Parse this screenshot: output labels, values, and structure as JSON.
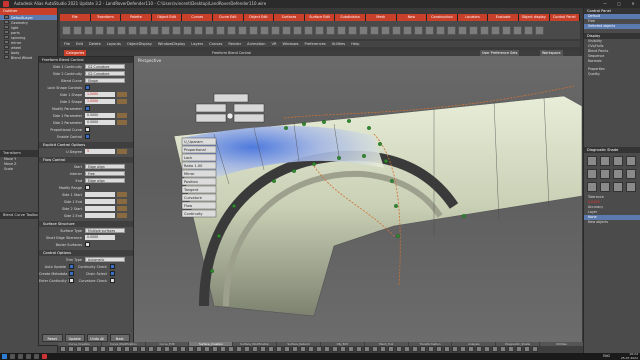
{
  "window": {
    "title": "Autodesk Alias AutoStudio 2021 Update 3.2 - LandRoverDefender110 - C:\\Users\\vincent\\Desktop\\LandRoverDefender110.wire"
  },
  "shelf_tabs": [
    "File",
    "Transform",
    "Palette",
    "Object Edit",
    "Curves",
    "Curve Edit",
    "Object Edit",
    "Surfaces",
    "Surface Edit",
    "Subdivision",
    "Mesh",
    "New",
    "Construction",
    "Locators",
    "Evaluate",
    "Object display",
    "Control Panel"
  ],
  "menu": [
    "File",
    "Edit",
    "Delete",
    "Layouts",
    "ObjectDisplay",
    "WindowDisplay",
    "Layers",
    "Canvas",
    "Render",
    "Animation",
    "VR",
    "Windows",
    "Preferences",
    "Utilities",
    "Help"
  ],
  "subbar": {
    "category": "Categories",
    "tool": "Freeform Blend Control",
    "user_prefs": "User Preference Sets",
    "workspace": "Workspace"
  },
  "outliner": {
    "header": "Outliner",
    "items": [
      "DefaultLayer",
      "Geometry",
      "light",
      "parts",
      "spinning",
      "mirror",
      "wheel",
      "body",
      "Blend Wheel"
    ]
  },
  "left_misc": {
    "transform": "Transform",
    "move_y": "Move Y",
    "move_z": "Move Z",
    "scale": "Scale",
    "curve_view": "Blend Curve Toolbox"
  },
  "control_panel": {
    "title": "Freeform Blend Control",
    "rows": [
      {
        "label": "Side 1 Continuity",
        "value": "G2 Curvature"
      },
      {
        "label": "Side 2 Continuity",
        "value": "G2 Curvature"
      },
      {
        "label": "Blend Curve",
        "value": "Shape"
      },
      {
        "label": "Lock Shape Controls",
        "value": ""
      },
      {
        "label": "Side 1 Shape",
        "value": "1.0000"
      },
      {
        "label": "Side 2 Shape",
        "value": "1.0000"
      },
      {
        "label": "Modify Parameter",
        "value": ""
      },
      {
        "label": "Side 1 Parameter",
        "value": "0.5000"
      },
      {
        "label": "Side 2 Parameter",
        "value": "0.5000"
      },
      {
        "label": "Proportional Curve",
        "value": ""
      },
      {
        "label": "Enable Control",
        "value": ""
      }
    ],
    "section_explicit": "Explicit Control Options",
    "udegree_label": "U Degree",
    "udegree_value": "5",
    "section_flow": "Flow Control",
    "flow_rows": [
      {
        "label": "Start",
        "value": "Edge align"
      },
      {
        "label": "Interior",
        "value": "Free"
      },
      {
        "label": "End",
        "value": "Edge align"
      }
    ],
    "modify_range": "Modify Range",
    "range_rows": [
      "Side 1 Start",
      "Side 1 End",
      "Side 2 Start",
      "Side 2 End"
    ],
    "section_structure": "Surface Structure",
    "surface_type_label": "Surface Type",
    "surface_type_value": "Multiple surfaces",
    "short_edge_label": "Short Edge Tolerance",
    "short_edge_value": "0.0000",
    "bezier_label": "Bezier Surfaces",
    "section_options": "Control Options",
    "trim_type_label": "Trim Type",
    "trim_type_value": "Automatic",
    "auto_update": "Auto Update",
    "continuity_check": "Continuity Check",
    "create_metadata": "Create Metadata",
    "chain_select": "Chain Select",
    "enter_continuity": "Enter Continuity Check",
    "curvature_check": "Curvature Check",
    "buttons": [
      "Reset",
      "Update",
      "Undo All",
      "Next"
    ]
  },
  "viewport": {
    "label": "Perspective",
    "tags": [
      "U_Uparam",
      "Proportional",
      "Lock",
      "Ratio 1.00",
      "Mirror",
      "Position",
      "Tangent",
      "Curvature",
      "Flow",
      "Continuity"
    ]
  },
  "right_panel": {
    "header": "Control Panel",
    "layout": "Default",
    "mode_label": "Free",
    "selected_label": "Selected objects",
    "display_header": "Display",
    "display_rows": [
      "Visibility",
      "CVs/Hulls",
      "Blend Points",
      "Sequence",
      "Normals"
    ],
    "properties": [
      "Properties",
      "Quality"
    ],
    "diag_header": "Diagnostic Shade",
    "tolerance_label": "Tolerance",
    "tolerance_value": "0.0100",
    "accuracy_label": "Accuracy",
    "layer_label": "Layer",
    "layer_value": "None",
    "new_objects": "New objects"
  },
  "bottom_tabs": [
    "Curve_Creation",
    "Curve_Modification",
    "Curve_Edit",
    "Surface_Creation",
    "Surface_Modification",
    "Surface_Rebuild",
    "Obj_Edit",
    "Mesh_Tool",
    "Transformation",
    "Analysis",
    "Diagnostic_Shade",
    "Utilities"
  ],
  "active_bottom_tab": "Surface_Creation",
  "taskbar": {
    "lang": "ENG",
    "time": "16:24",
    "date": "25.07.2022"
  },
  "colors": {
    "accent_tab": "#c9402a",
    "selection": "#5a7ab0",
    "cv_point": "#2e8b2e",
    "surface_highlight": "#4a6fd6"
  }
}
